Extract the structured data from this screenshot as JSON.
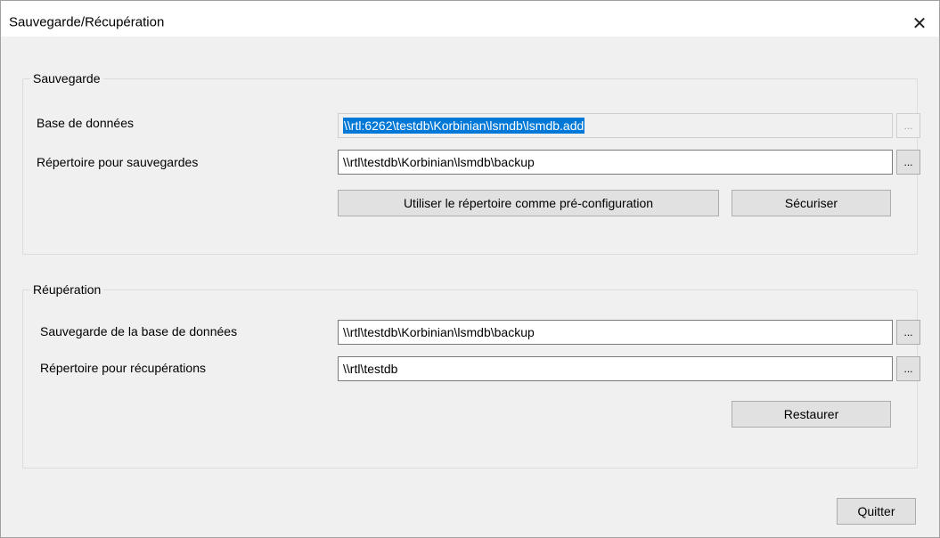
{
  "window": {
    "title": "Sauvegarde/Récupération",
    "close_glyph": "✕"
  },
  "backup": {
    "legend": "Sauvegarde",
    "db_label": "Base de données",
    "db_value": "\\\\rtl:6262\\testdb\\Korbinian\\lsmdb\\lsmdb.add",
    "dir_label": "Répertoire pour sauvegardes",
    "dir_value": "\\\\rtl\\testdb\\Korbinian\\lsmdb\\backup",
    "browse_label": "...",
    "preset_button": "Utiliser le répertoire comme pré-configuration",
    "secure_button": "Sécuriser"
  },
  "restore": {
    "legend": "Réupération",
    "backup_label": "Sauvegarde de la base de données",
    "backup_value": "\\\\rtl\\testdb\\Korbinian\\lsmdb\\backup",
    "dir_label": "Répertoire pour récupérations",
    "dir_value": "\\\\rtl\\testdb",
    "browse_label": "...",
    "restore_button": "Restaurer"
  },
  "footer": {
    "quit_button": "Quitter"
  }
}
